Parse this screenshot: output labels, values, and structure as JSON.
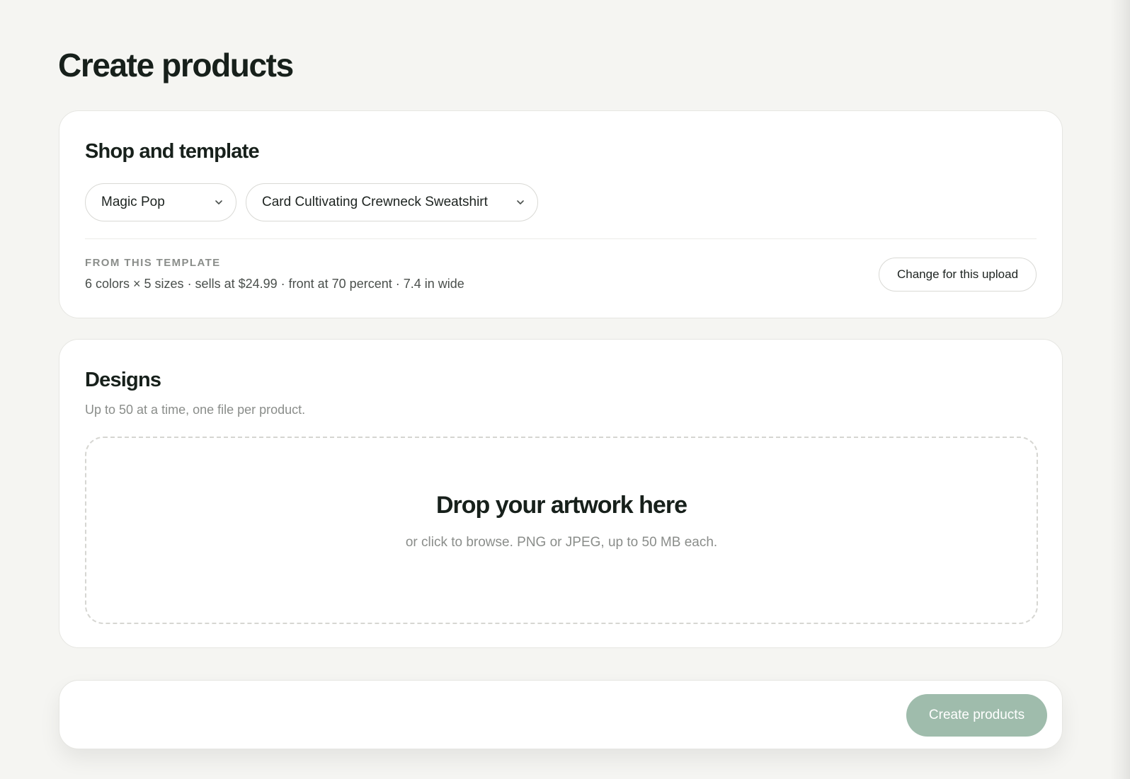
{
  "page": {
    "title": "Create products"
  },
  "shop_template": {
    "title": "Shop and template",
    "shop_select": {
      "value": "Magic Pop",
      "icon": "chevron-down-icon"
    },
    "template_select": {
      "value": "Card Cultivating Crewneck Sweatshirt",
      "icon": "chevron-down-icon"
    },
    "template_label": "FROM THIS TEMPLATE",
    "template_summary": "6 colors × 5 sizes · sells at $24.99 · front at 70 percent · 7.4 in wide",
    "change_button_label": "Change for this upload"
  },
  "designs": {
    "title": "Designs",
    "subtitle": "Up to 50 at a time, one file per product.",
    "dropzone": {
      "title": "Drop your artwork here",
      "subtitle": "or click to browse. PNG or JPEG, up to 50 MB each."
    }
  },
  "footer": {
    "create_button_label": "Create products",
    "create_button_color": "#9fbcac"
  },
  "colors": {
    "background": "#f5f5f2",
    "card": "#ffffff",
    "text": "#17201b",
    "muted": "#8a8d8a"
  }
}
